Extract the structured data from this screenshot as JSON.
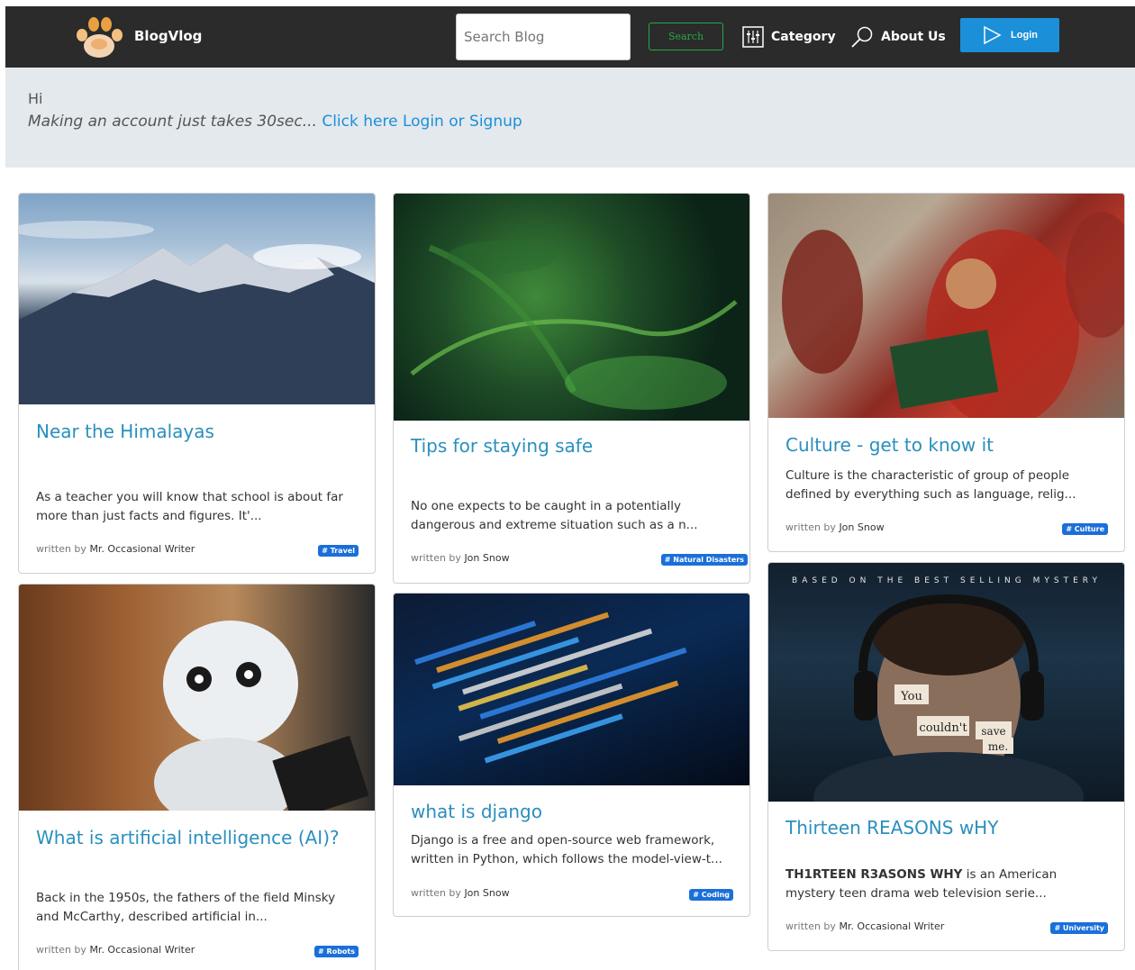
{
  "navbar": {
    "brand": "BlogVlog",
    "search_placeholder": "Search Blog",
    "search_button": "Search",
    "category": "Category",
    "about": "About Us",
    "login": "Login"
  },
  "banner": {
    "greeting": "Hi",
    "prompt": "Making an account just takes 30sec...",
    "link": "Click here Login or Signup"
  },
  "posts": [
    {
      "title": "Near the Himalayas",
      "excerpt": "As a teacher you will know that school is about far more than just facts and figures. It'...",
      "written_by": "written by",
      "author": "Mr. Occasional Writer",
      "tag": "# Travel"
    },
    {
      "title": "Tips for staying safe",
      "excerpt": "No one expects to be caught in a potentially dangerous and extreme situation such as a n...",
      "written_by": "written by",
      "author": "Jon Snow",
      "tag": "# Natural Disasters"
    },
    {
      "title": "Culture - get to know it",
      "excerpt": "Culture is the characteristic of group of people defined by everything such as language, relig...",
      "written_by": "written by",
      "author": "Jon Snow",
      "tag": "# Culture"
    },
    {
      "title": "What is artificial intelligence (AI)?",
      "excerpt": "Back in the 1950s, the fathers of the field Minsky and McCarthy, described artificial in...",
      "written_by": "written by",
      "author": "Mr. Occasional Writer",
      "tag": "# Robots"
    },
    {
      "title": "what is django",
      "excerpt": "Django is a free and open-source web framework, written in Python, which follows the model-view-t...",
      "written_by": "written by",
      "author": "Jon Snow",
      "tag": "# Coding"
    },
    {
      "title": "Thirteen REASONS wHY",
      "excerpt_bold": "TH1RTEEN R3ASONS WHY",
      "excerpt": " is an American mystery teen drama web television serie...",
      "written_by": "written by",
      "author": "Mr. Occasional Writer",
      "tag": "# University"
    }
  ],
  "poster": {
    "top_text": "BASED ON THE BEST SELLING MYSTERY",
    "notes": [
      "You",
      "couldn't",
      "save",
      "me."
    ]
  },
  "colors": {
    "navbar": "#2b2b2b",
    "accent": "#1b8fd8",
    "title": "#2a8fbd",
    "tag": "#1b6fd8",
    "banner": "#e4e9ee"
  }
}
